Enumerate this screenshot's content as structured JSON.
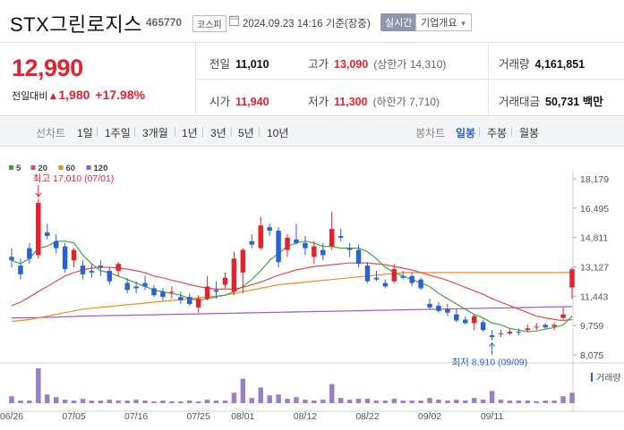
{
  "header": {
    "stock_name": "STX그린로지스",
    "stock_code": "465770",
    "market": "코스피",
    "datetime": "2024.09.23 14:16",
    "basis": "기준(장중)",
    "realtime_label": "실시간",
    "corp_info_label": "기업개요"
  },
  "summary": {
    "current_price": "12,990",
    "change_label": "전일대비",
    "change_arrow": "▲",
    "change_value": "1,980",
    "change_pct": "+17.98%",
    "prev_close_label": "전일",
    "prev_close": "11,010",
    "open_label": "시가",
    "open": "11,940",
    "high_label": "고가",
    "high": "13,090",
    "upper_limit": "(상한가 14,310)",
    "low_label": "저가",
    "low": "11,300",
    "lower_limit": "(하한가 7,710)",
    "volume_label": "거래량",
    "volume": "4,161,851",
    "amount_label": "거래대금",
    "amount": "50,731 백만"
  },
  "periods": {
    "line_label": "선차트",
    "line_options": [
      "1일",
      "1주일",
      "3개월",
      "1년",
      "3년",
      "5년",
      "10년"
    ],
    "candle_label": "봉차트",
    "candle_options": [
      "일봉",
      "주봉",
      "월봉"
    ],
    "selected": "일봉"
  },
  "colors": {
    "up": "#e4222e",
    "down": "#2a62d0",
    "ma5": "#3aaa35",
    "ma20": "#e34b4b",
    "ma60": "#f08a1c",
    "ma120": "#9b59c9",
    "volume": "#9b7ec8"
  },
  "chart_data": {
    "type": "candlestick",
    "legend": [
      {
        "name": "5",
        "color": "#3aaa35"
      },
      {
        "name": "20",
        "color": "#e34b4b"
      },
      {
        "name": "60",
        "color": "#f08a1c"
      },
      {
        "name": "120",
        "color": "#9b59c9"
      }
    ],
    "y_ticks": [
      "18,179",
      "16,495",
      "14,811",
      "13,127",
      "11,443",
      "9,759",
      "8,075"
    ],
    "ylim": [
      8075,
      18179
    ],
    "x_ticks": [
      "06/26",
      "07/05",
      "07/16",
      "07/25",
      "08/01",
      "08/12",
      "08/22",
      "09/02",
      "09/11"
    ],
    "x_tick_index": [
      0,
      7,
      14,
      21,
      26,
      33,
      40,
      47,
      54
    ],
    "high_annotation": "최고 17,010 (07/01)",
    "low_annotation": "최저 8,910 (09/09)",
    "volume_label": "거래량",
    "candles": [
      [
        13700,
        14200,
        13100,
        13500
      ],
      [
        13200,
        13600,
        12400,
        12700
      ],
      [
        14200,
        14500,
        13300,
        13600
      ],
      [
        13800,
        17010,
        13600,
        16800
      ],
      [
        15100,
        15600,
        14700,
        14900
      ],
      [
        14600,
        15000,
        13900,
        14200
      ],
      [
        14300,
        14500,
        12800,
        13000
      ],
      [
        13500,
        14200,
        13100,
        14100
      ],
      [
        13200,
        13500,
        12400,
        12700
      ],
      [
        12900,
        13300,
        12500,
        12800
      ],
      [
        13200,
        13500,
        12600,
        13100
      ],
      [
        12900,
        13100,
        12100,
        12300
      ],
      [
        12900,
        13400,
        12600,
        13300
      ],
      [
        12200,
        12500,
        11600,
        11800
      ],
      [
        12000,
        12300,
        11600,
        11900
      ],
      [
        12200,
        12600,
        11800,
        12000
      ],
      [
        11900,
        12100,
        11400,
        11500
      ],
      [
        11700,
        11900,
        11200,
        11400
      ],
      [
        11700,
        12000,
        11300,
        11700
      ],
      [
        11400,
        11700,
        11000,
        11200
      ],
      [
        11400,
        11600,
        10900,
        11000
      ],
      [
        10800,
        11500,
        10500,
        11300
      ],
      [
        11300,
        12600,
        11200,
        12000
      ],
      [
        11800,
        12300,
        11300,
        11700
      ],
      [
        12100,
        12800,
        11900,
        12500
      ],
      [
        11700,
        14000,
        11500,
        13600
      ],
      [
        12800,
        14200,
        11600,
        14100
      ],
      [
        14600,
        15000,
        14200,
        14400
      ],
      [
        14200,
        16000,
        14100,
        15500
      ],
      [
        15400,
        15600,
        14900,
        15200
      ],
      [
        15200,
        15400,
        13100,
        13400
      ],
      [
        14100,
        15000,
        13700,
        14800
      ],
      [
        14700,
        15600,
        14400,
        14500
      ],
      [
        14500,
        14900,
        13800,
        14200
      ],
      [
        13700,
        14600,
        13300,
        14300
      ],
      [
        14100,
        14500,
        13500,
        13800
      ],
      [
        14300,
        16300,
        14100,
        15300
      ],
      [
        14900,
        15300,
        14600,
        14800
      ],
      [
        14200,
        14500,
        13700,
        14100
      ],
      [
        14100,
        14400,
        13100,
        13300
      ],
      [
        13200,
        13400,
        12200,
        12300
      ],
      [
        12500,
        12900,
        12300,
        12400
      ],
      [
        12200,
        12400,
        11900,
        12000
      ],
      [
        12300,
        13300,
        12200,
        13000
      ],
      [
        12600,
        12900,
        12400,
        12500
      ],
      [
        12600,
        12800,
        12000,
        12200
      ],
      [
        12400,
        12500,
        11800,
        11900
      ],
      [
        11000,
        11300,
        10700,
        10800
      ],
      [
        10900,
        11100,
        10500,
        10600
      ],
      [
        10700,
        11000,
        10300,
        10500
      ],
      [
        10400,
        10700,
        9950,
        10050
      ],
      [
        10100,
        10300,
        9800,
        9900
      ],
      [
        9900,
        10400,
        9500,
        10300
      ],
      [
        9950,
        10100,
        9400,
        9500
      ],
      [
        9200,
        9500,
        8910,
        9100
      ],
      [
        9300,
        9500,
        9100,
        9300
      ],
      [
        9300,
        9600,
        9200,
        9400
      ],
      [
        9400,
        9600,
        9200,
        9350
      ],
      [
        9500,
        9800,
        9400,
        9600
      ],
      [
        9700,
        9900,
        9500,
        9700
      ],
      [
        9800,
        9900,
        9550,
        9650
      ],
      [
        9700,
        9950,
        9500,
        9800
      ],
      [
        10200,
        10800,
        10100,
        10400
      ],
      [
        11940,
        13090,
        11300,
        12990
      ]
    ],
    "ma5": [
      13500,
      13300,
      13600,
      14200,
      14300,
      14600,
      14600,
      14500,
      13800,
      13300,
      12900,
      12800,
      12600,
      12400,
      12200,
      12000,
      11800,
      11700,
      11600,
      11500,
      11300,
      11200,
      11300,
      11400,
      11500,
      11700,
      12000,
      12400,
      12900,
      13500,
      13900,
      14300,
      14500,
      14600,
      14500,
      14300,
      14300,
      14200,
      14200,
      14200,
      14000,
      13600,
      13100,
      12800,
      12600,
      12400,
      12200,
      12000,
      11600,
      11300,
      11000,
      10700,
      10400,
      10200,
      9900,
      9800,
      9600,
      9500,
      9400,
      9450,
      9550,
      9650,
      9800,
      10300
    ],
    "ma20": [
      10900,
      11100,
      11400,
      11700,
      12000,
      12300,
      12600,
      12800,
      12950,
      13050,
      13100,
      13100,
      13050,
      13000,
      12900,
      12800,
      12600,
      12500,
      12350,
      12250,
      12100,
      12000,
      11900,
      11850,
      11850,
      11850,
      11950,
      12100,
      12250,
      12450,
      12650,
      12800,
      12950,
      13050,
      13150,
      13200,
      13250,
      13300,
      13350,
      13350,
      13350,
      13300,
      13250,
      13150,
      13050,
      12950,
      12800,
      12650,
      12500,
      12350,
      12150,
      11950,
      11750,
      11550,
      11300,
      11100,
      10900,
      10700,
      10500,
      10300,
      10200,
      10100,
      10050,
      10100
    ],
    "ma60": [
      10000,
      10050,
      10100,
      10200,
      10300,
      10400,
      10500,
      10600,
      10700,
      10750,
      10800,
      10850,
      10900,
      10950,
      11000,
      11050,
      11100,
      11150,
      11200,
      11250,
      11300,
      11350,
      11400,
      11450,
      11500,
      11600,
      11700,
      11800,
      11900,
      12000,
      12100,
      12150,
      12200,
      12250,
      12300,
      12350,
      12400,
      12450,
      12500,
      12550,
      12600,
      12650,
      12700,
      12750,
      12800,
      12800,
      12800,
      12800,
      12800,
      12800,
      12800,
      12800,
      12800,
      12800,
      12800,
      12800,
      12800,
      12800,
      12800,
      12800,
      12800,
      12800,
      12800,
      12800
    ],
    "ma120": [
      10200,
      10200,
      10210,
      10220,
      10230,
      10240,
      10260,
      10280,
      10300,
      10310,
      10320,
      10330,
      10340,
      10350,
      10360,
      10370,
      10380,
      10390,
      10400,
      10410,
      10420,
      10430,
      10440,
      10450,
      10460,
      10470,
      10480,
      10490,
      10500,
      10510,
      10520,
      10530,
      10540,
      10550,
      10560,
      10570,
      10580,
      10590,
      10600,
      10610,
      10620,
      10630,
      10640,
      10650,
      10660,
      10670,
      10680,
      10690,
      10700,
      10710,
      10720,
      10730,
      10740,
      10750,
      10760,
      10770,
      10780,
      10790,
      10800,
      10810,
      10820,
      10830,
      10840,
      10850
    ],
    "volumes": [
      8,
      3,
      3,
      40,
      10,
      7,
      4,
      3,
      5,
      3,
      3,
      4,
      3,
      3,
      4,
      3,
      2,
      3,
      2,
      2,
      3,
      2,
      4,
      3,
      3,
      12,
      28,
      6,
      18,
      9,
      10,
      5,
      7,
      4,
      3,
      4,
      22,
      6,
      4,
      5,
      5,
      3,
      3,
      5,
      3,
      3,
      3,
      6,
      4,
      3,
      4,
      3,
      6,
      4,
      14,
      4,
      3,
      3,
      3,
      2,
      3,
      3,
      8,
      12
    ]
  }
}
